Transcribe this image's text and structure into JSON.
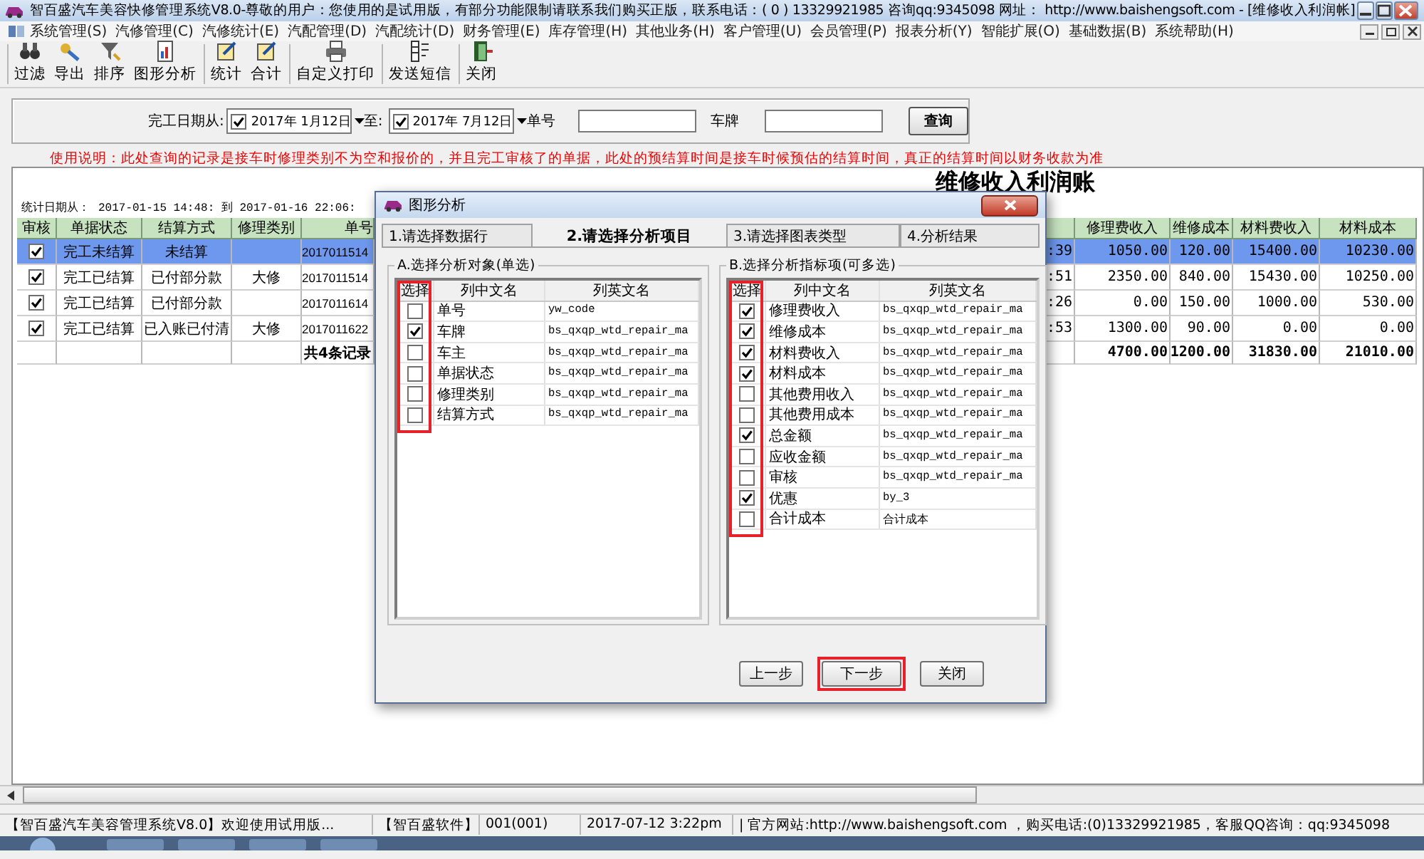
{
  "window": {
    "title": "智百盛汽车美容快修管理系统V8.0-尊敬的用户：您使用的是试用版，有部分功能限制请联系我们购买正版，联系电话：( 0 ) 13329921985  咨询qq:9345098   网址： http://www.baishengsoft.com - [维修收入利润帐]"
  },
  "menu": [
    "系统管理(S)",
    "汽修管理(C)",
    "汽修统计(E)",
    "汽配管理(D)",
    "汽配统计(D)",
    "财务管理(E)",
    "库存管理(H)",
    "其他业务(H)",
    "客户管理(U)",
    "会员管理(P)",
    "报表分析(Y)",
    "智能扩展(O)",
    "基础数据(B)",
    "系统帮助(H)"
  ],
  "toolbar": [
    [
      "过滤",
      "导出",
      "排序",
      "图形分析"
    ],
    [
      "统计",
      "合计"
    ],
    [
      "自定义打印"
    ],
    [
      "发送短信"
    ],
    [
      "关闭"
    ]
  ],
  "filter": {
    "date_label": "完工日期从:",
    "date_from": {
      "checked": true,
      "value": "2017年 1月12日"
    },
    "to_label": "至:",
    "date_to": {
      "checked": true,
      "value": "2017年 7月12日"
    },
    "order_label": "单号",
    "plate_label": "车牌",
    "search_button": "查询"
  },
  "note": "使用说明：此处查询的记录是接车时修理类别不为空和报价的，并且完工审核了的单据，此处的预结算时间是接车时候预估的结算时间，真正的结算时间以财务收款为准",
  "report": {
    "title": "维修收入利润账",
    "period_label": "统计日期从：",
    "period": "2017-01-15 14:48: 到  2017-01-16 22:06:",
    "columns_left": [
      "审核",
      "单据状态",
      "结算方式",
      "修理类别",
      "单号"
    ],
    "columns_right": [
      "修理费收入",
      "维修成本",
      "材料费收入",
      "材料成本"
    ],
    "rows": [
      {
        "selected": true,
        "checked": true,
        "status": "完工未结算",
        "settlement": "未结算",
        "number": "2017011514",
        "time": ":39",
        "values": [
          "1050.00",
          "120.00",
          "15400.00",
          "10230.00"
        ]
      },
      {
        "selected": false,
        "checked": true,
        "status": "完工已结算",
        "settlement": "已付部分款",
        "category": "大修",
        "number": "2017011514",
        "time": ":51",
        "values": [
          "2350.00",
          "840.00",
          "15430.00",
          "10250.00"
        ]
      },
      {
        "selected": false,
        "checked": true,
        "status": "完工已结算",
        "settlement": "已付部分款",
        "number": "2017011614",
        "time": ":26",
        "values": [
          "0.00",
          "150.00",
          "1000.00",
          "530.00"
        ]
      },
      {
        "selected": false,
        "checked": true,
        "status": "完工已结算",
        "settlement": "已入账已付清",
        "category": "大修",
        "number": "2017011622",
        "time": ":53",
        "values": [
          "1300.00",
          "90.00",
          "0.00",
          "0.00"
        ]
      }
    ],
    "total": {
      "label": "共4条记录",
      "values": [
        "4700.00",
        "1200.00",
        "31830.00",
        "21010.00"
      ]
    }
  },
  "dialog": {
    "title": "图形分析",
    "tabs": [
      {
        "label": "1.请选择数据行",
        "selected": false
      },
      {
        "label": "2.请选择分析项目",
        "selected": true
      },
      {
        "label": "3.请选择图表类型",
        "selected": false
      },
      {
        "label": "4.分析结果",
        "selected": false
      }
    ],
    "groups": [
      {
        "title": "A.选择分析对象(单选)",
        "columns": [
          "选择",
          "列中文名",
          "列英文名"
        ],
        "highlighted": true,
        "rows": [
          {
            "checked": false,
            "name": "单号",
            "field": "yw_code"
          },
          {
            "checked": true,
            "name": "车牌",
            "field": "bs_qxqp_wtd_repair_ma"
          },
          {
            "checked": false,
            "name": "车主",
            "field": "bs_qxqp_wtd_repair_ma"
          },
          {
            "checked": false,
            "name": "单据状态",
            "field": "bs_qxqp_wtd_repair_ma"
          },
          {
            "checked": false,
            "name": "修理类别",
            "field": "bs_qxqp_wtd_repair_ma"
          },
          {
            "checked": false,
            "name": "结算方式",
            "field": "bs_qxqp_wtd_repair_ma"
          }
        ]
      },
      {
        "title": "B.选择分析指标项(可多选)",
        "columns": [
          "选择",
          "列中文名",
          "列英文名"
        ],
        "highlighted": true,
        "rows": [
          {
            "checked": true,
            "name": "修理费收入",
            "field": "bs_qxqp_wtd_repair_ma"
          },
          {
            "checked": true,
            "name": "维修成本",
            "field": "bs_qxqp_wtd_repair_ma"
          },
          {
            "checked": true,
            "name": "材料费收入",
            "field": "bs_qxqp_wtd_repair_ma"
          },
          {
            "checked": true,
            "name": "材料成本",
            "field": "bs_qxqp_wtd_repair_ma"
          },
          {
            "checked": false,
            "name": "其他费用收入",
            "field": "bs_qxqp_wtd_repair_ma"
          },
          {
            "checked": false,
            "name": "其他费用成本",
            "field": "bs_qxqp_wtd_repair_ma"
          },
          {
            "checked": true,
            "name": "总金额",
            "field": "bs_qxqp_wtd_repair_ma"
          },
          {
            "checked": false,
            "name": "应收金额",
            "field": "bs_qxqp_wtd_repair_ma"
          },
          {
            "checked": false,
            "name": "审核",
            "field": "bs_qxqp_wtd_repair_ma"
          },
          {
            "checked": true,
            "name": "优惠",
            "field": "by_3"
          },
          {
            "checked": false,
            "name": "合计成本",
            "field": "合计成本"
          }
        ]
      }
    ],
    "buttons": [
      {
        "label": "上一步",
        "highlighted": false
      },
      {
        "label": "下一步",
        "highlighted": true
      },
      {
        "label": "关闭",
        "highlighted": false
      }
    ]
  },
  "status_bar": [
    "【智百盛汽车美容管理系统V8.0】欢迎使用试用版...",
    "【智百盛软件】",
    "001(001)",
    "2017-07-12 3:22pm",
    "| 官方网站:http://www.baishengsoft.com ，购买电话:(0)13329921985，客服QQ咨询：qq:9345098"
  ]
}
